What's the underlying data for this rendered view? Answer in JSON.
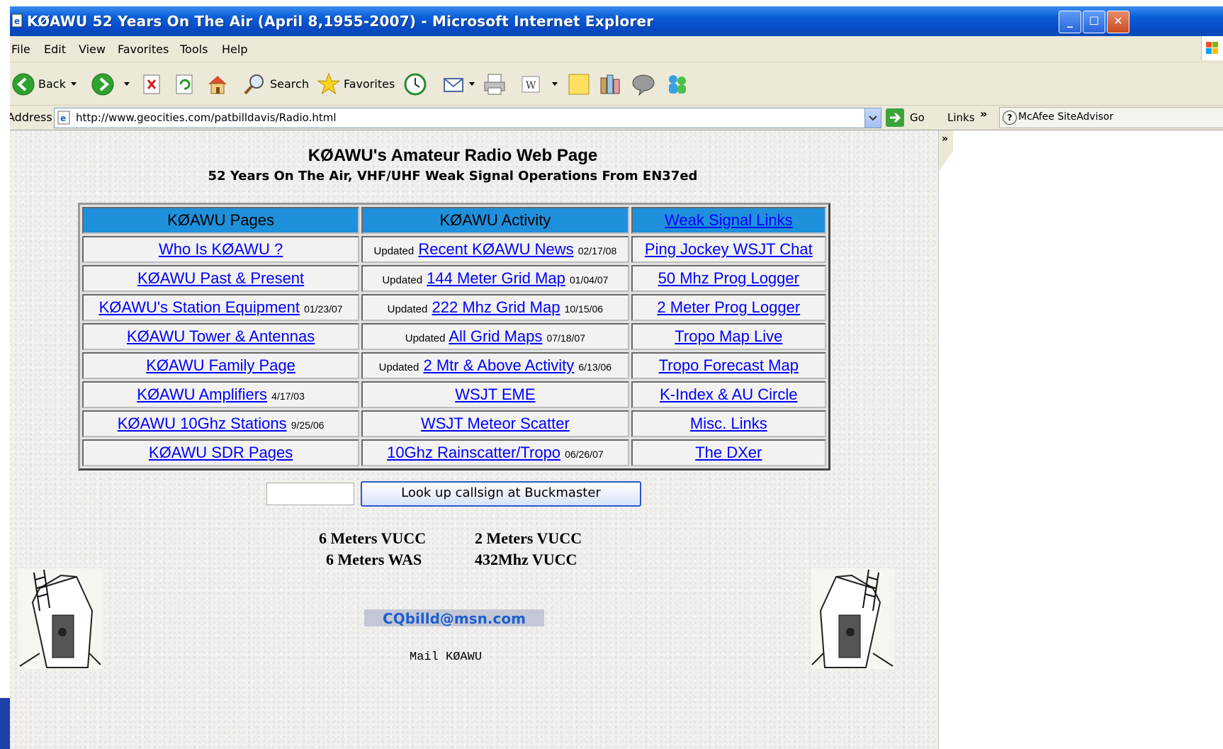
{
  "window": {
    "title": "KØAWU 52 Years On The Air (April 8,1955-2007) - Microsoft Internet Explorer"
  },
  "menu": [
    "File",
    "Edit",
    "View",
    "Favorites",
    "Tools",
    "Help"
  ],
  "toolbar": {
    "back": "Back",
    "search": "Search",
    "favorites": "Favorites"
  },
  "address": {
    "label": "Address",
    "url": "http://www.geocities.com/patbilldavis/Radio.html",
    "go": "Go",
    "links": "Links",
    "mcafee": "McAfee SiteAdvisor"
  },
  "page": {
    "title": "KØAWU's Amateur Radio Web Page",
    "subtitle": "52 Years On The Air, VHF/UHF Weak Signal Operations From EN37ed"
  },
  "table": {
    "headers": [
      "KØAWU Pages",
      "KØAWU Activity",
      "Weak Signal Links"
    ],
    "rows": [
      {
        "c1": {
          "link": "Who Is KØAWU ?",
          "date": ""
        },
        "c2": {
          "pre": "Updated",
          "link": "Recent KØAWU News",
          "date": "02/17/08"
        },
        "c3": {
          "link": "Ping Jockey WSJT Chat"
        }
      },
      {
        "c1": {
          "link": "KØAWU Past & Present",
          "date": ""
        },
        "c2": {
          "pre": "Updated",
          "link": "144 Meter Grid Map",
          "date": "01/04/07"
        },
        "c3": {
          "link": "50 Mhz Prog Logger"
        }
      },
      {
        "c1": {
          "link": "KØAWU's Station Equipment",
          "date": "01/23/07"
        },
        "c2": {
          "pre": "Updated",
          "link": "222 Mhz Grid Map",
          "date": "10/15/06"
        },
        "c3": {
          "link": "2 Meter Prog Logger"
        }
      },
      {
        "c1": {
          "link": "KØAWU Tower & Antennas",
          "date": ""
        },
        "c2": {
          "pre": "Updated",
          "link": "All Grid Maps",
          "date": "07/18/07"
        },
        "c3": {
          "link": "Tropo Map Live"
        }
      },
      {
        "c1": {
          "link": "KØAWU Family Page",
          "date": ""
        },
        "c2": {
          "pre": "Updated",
          "link": "2 Mtr & Above Activity",
          "date": "6/13/06"
        },
        "c3": {
          "link": "Tropo Forecast Map"
        }
      },
      {
        "c1": {
          "link": "KØAWU Amplifiers",
          "date": "4/17/03"
        },
        "c2": {
          "pre": "",
          "link": "WSJT EME",
          "date": ""
        },
        "c3": {
          "link": "K-Index & AU Circle"
        }
      },
      {
        "c1": {
          "link": "KØAWU 10Ghz Stations",
          "date": "9/25/06"
        },
        "c2": {
          "pre": "",
          "link": "WSJT Meteor Scatter",
          "date": ""
        },
        "c3": {
          "link": "Misc. Links"
        }
      },
      {
        "c1": {
          "link": "KØAWU SDR Pages",
          "date": ""
        },
        "c2": {
          "pre": "",
          "link": "10Ghz Rainscatter/Tropo",
          "date": "06/26/07"
        },
        "c3": {
          "link": "The DXer"
        }
      }
    ]
  },
  "lookup": {
    "button": "Look up callsign at Buckmaster",
    "value": ""
  },
  "awards": {
    "six_vucc": "6 Meters VUCC",
    "two_vucc": "2 Meters VUCC",
    "six_was": "6 Meters WAS",
    "uhf_vucc": "432Mhz VUCC"
  },
  "contact": {
    "email": "CQbilld@msn.com",
    "mail": "Mail KØAWU"
  },
  "colors": {
    "titlebar": "#0a5fd8",
    "header_cell": "#1e90dc",
    "link": "#0000ff",
    "email": "#1e5fd0"
  }
}
